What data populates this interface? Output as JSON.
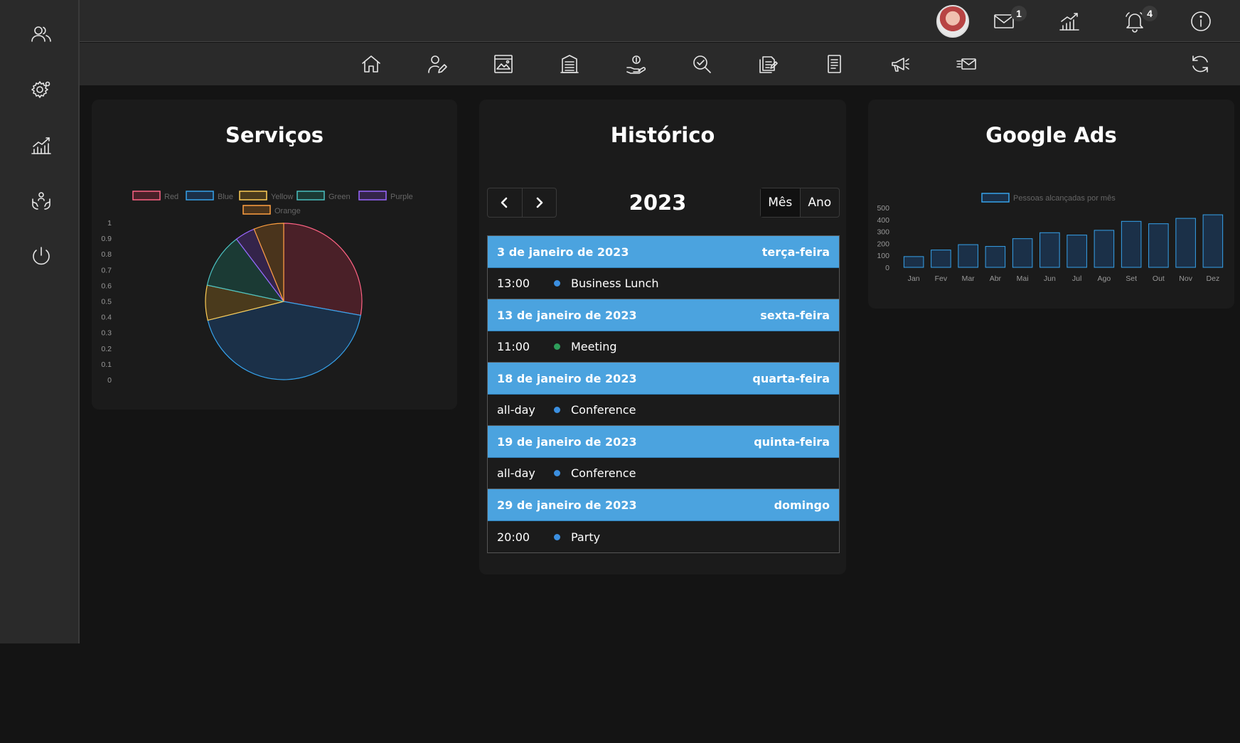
{
  "sidebar": {
    "items": [
      {
        "icon": "users-icon",
        "label": "Usuários"
      },
      {
        "icon": "settings-icon",
        "label": "Configurações"
      },
      {
        "icon": "analytics-icon",
        "label": "Estatísticas"
      },
      {
        "icon": "support-hands-icon",
        "label": "Serviços"
      },
      {
        "icon": "power-icon",
        "label": "Sair"
      }
    ]
  },
  "topbar": {
    "mail_count": "1",
    "notification_count": "4"
  },
  "navbar": {
    "icons": [
      "home-icon",
      "user-edit-icon",
      "gallery-icon",
      "building-icon",
      "hand-coin-icon",
      "search-check-icon",
      "documents-edit-icon",
      "notepad-icon",
      "megaphone-icon",
      "mail-send-icon",
      "refresh-icon"
    ]
  },
  "services": {
    "title": "Serviços",
    "legend": [
      "Red",
      "Blue",
      "Yellow",
      "Green",
      "Purple",
      "Orange"
    ]
  },
  "history": {
    "title": "Histórico",
    "year": "2023",
    "view_month": "Mês",
    "view_year": "Ano",
    "days": [
      {
        "date": "3 de janeiro de 2023",
        "weekday": "terça-feira",
        "events": [
          {
            "time": "13:00",
            "title": "Business Lunch",
            "color": "#3b8fe0"
          }
        ]
      },
      {
        "date": "13 de janeiro de 2023",
        "weekday": "sexta-feira",
        "events": [
          {
            "time": "11:00",
            "title": "Meeting",
            "color": "#2e9e5b"
          }
        ]
      },
      {
        "date": "18 de janeiro de 2023",
        "weekday": "quarta-feira",
        "events": [
          {
            "time": "all-day",
            "title": "Conference",
            "color": "#3b8fe0"
          }
        ]
      },
      {
        "date": "19 de janeiro de 2023",
        "weekday": "quinta-feira",
        "events": [
          {
            "time": "all-day",
            "title": "Conference",
            "color": "#3b8fe0"
          }
        ]
      },
      {
        "date": "29 de janeiro de 2023",
        "weekday": "domingo",
        "events": [
          {
            "time": "20:00",
            "title": "Party",
            "color": "#3b8fe0"
          }
        ]
      }
    ]
  },
  "ads": {
    "title": "Google Ads"
  },
  "chart_data": [
    {
      "type": "pie",
      "title": "Serviços",
      "categories": [
        "Red",
        "Blue",
        "Yellow",
        "Green",
        "Purple",
        "Orange"
      ],
      "values": [
        27,
        42,
        7,
        11,
        4,
        6
      ],
      "colors": {
        "fill": [
          "#4a2028",
          "#1b3048",
          "#4a3a1c",
          "#1b3a34",
          "#34244a",
          "#4a341c"
        ],
        "stroke": [
          "#ff6384",
          "#36a2eb",
          "#ffce56",
          "#4bc0c0",
          "#9966ff",
          "#ff9f40"
        ]
      },
      "y_ticks": [
        "1",
        "0.9",
        "0.8",
        "0.7",
        "0.6",
        "0.5",
        "0.4",
        "0.3",
        "0.2",
        "0.1",
        "0"
      ]
    },
    {
      "type": "bar",
      "title": "Google Ads",
      "series": [
        {
          "name": "Pessoas alcançadas por mês",
          "values": [
            90,
            145,
            190,
            175,
            240,
            290,
            270,
            310,
            385,
            365,
            410,
            440
          ]
        }
      ],
      "categories": [
        "Jan",
        "Fev",
        "Mar",
        "Abr",
        "Mai",
        "Jun",
        "Jul",
        "Ago",
        "Set",
        "Out",
        "Nov",
        "Dez"
      ],
      "ylim": [
        0,
        500
      ],
      "y_ticks": [
        0,
        100,
        200,
        300,
        400,
        500
      ],
      "colors": {
        "fill": "#1b3048",
        "stroke": "#36a2eb"
      }
    }
  ]
}
